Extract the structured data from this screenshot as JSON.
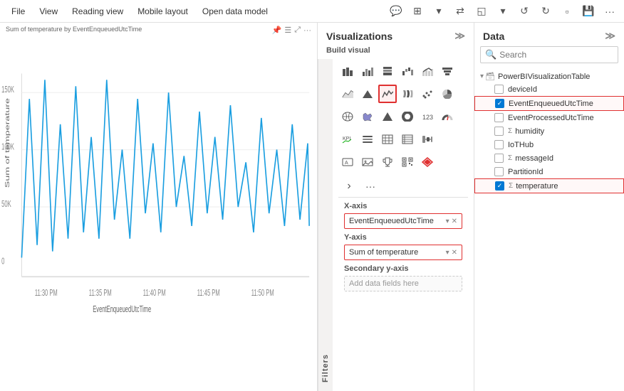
{
  "menubar": {
    "items": [
      "File",
      "View",
      "Reading view",
      "Mobile layout",
      "Open data model"
    ],
    "icons": [
      "💬",
      "⊞",
      "▣",
      "⇄",
      "◱",
      "↺",
      "↻",
      "▫",
      "💾",
      "···"
    ]
  },
  "chart": {
    "title": "Sum of temperature by EventEnqueuedUtcTime"
  },
  "viz_panel": {
    "title": "Visualizations",
    "subtitle": "Build visual",
    "filters_tab": "Filters"
  },
  "fields": {
    "xaxis_label": "X-axis",
    "xaxis_value": "EventEnqueuedUtcTime",
    "yaxis_label": "Y-axis",
    "yaxis_value": "Sum of temperature",
    "secondary_label": "Secondary y-axis",
    "secondary_placeholder": "Add data fields here"
  },
  "data_panel": {
    "title": "Data",
    "search_placeholder": "Search",
    "table_name": "PowerBIVisualizationTable",
    "fields": [
      {
        "name": "deviceId",
        "checked": false,
        "sigma": false
      },
      {
        "name": "EventEnqueuedUtcTime",
        "checked": true,
        "sigma": false,
        "highlighted": true
      },
      {
        "name": "EventProcessedUtcTime",
        "checked": false,
        "sigma": false
      },
      {
        "name": "humidity",
        "checked": false,
        "sigma": true
      },
      {
        "name": "IoTHub",
        "checked": false,
        "sigma": false
      },
      {
        "name": "messageId",
        "checked": false,
        "sigma": true
      },
      {
        "name": "PartitionId",
        "checked": false,
        "sigma": false
      },
      {
        "name": "temperature",
        "checked": true,
        "sigma": true,
        "highlighted": true
      }
    ]
  }
}
